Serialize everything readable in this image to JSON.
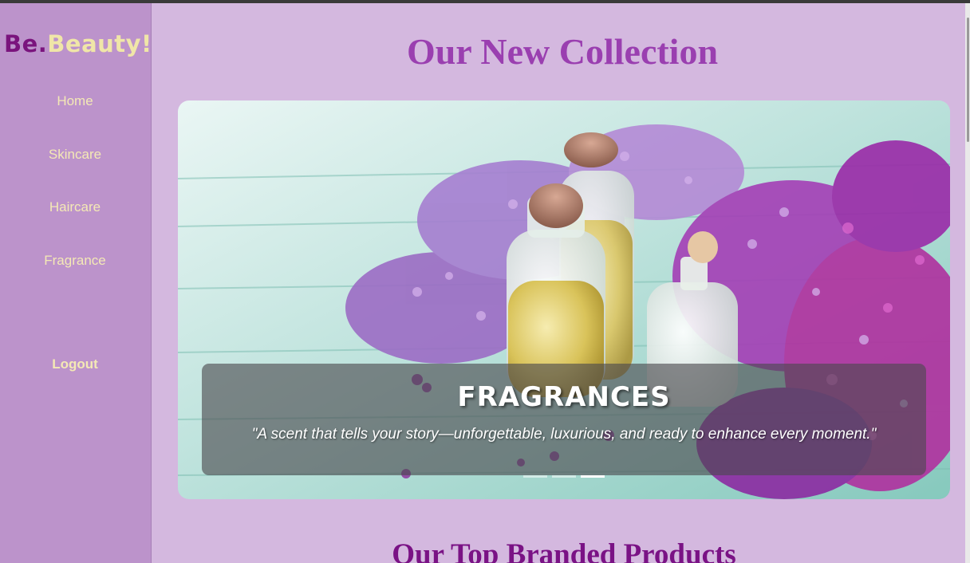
{
  "logo": {
    "be": "Be.",
    "beauty": "Beauty!"
  },
  "nav": {
    "items": [
      {
        "label": "Home"
      },
      {
        "label": "Skincare"
      },
      {
        "label": "Haircare"
      },
      {
        "label": "Fragrance"
      }
    ],
    "logout": "Logout"
  },
  "main": {
    "title": "Our New Collection",
    "carousel": {
      "caption_title": "FRAGRANCES",
      "caption_text": "\"A scent that tells your story—unforgettable, luxurious, and ready to enhance every moment.\"",
      "slide_count": 3,
      "active_slide": 3
    },
    "section_title": "Our Top Branded Products"
  },
  "colors": {
    "page_bg": "#d4b8df",
    "sidebar_bg": "#bc93cb",
    "title": "#9a3fb0",
    "nav_text": "#f4e9b5",
    "section_title": "#7a1285"
  }
}
